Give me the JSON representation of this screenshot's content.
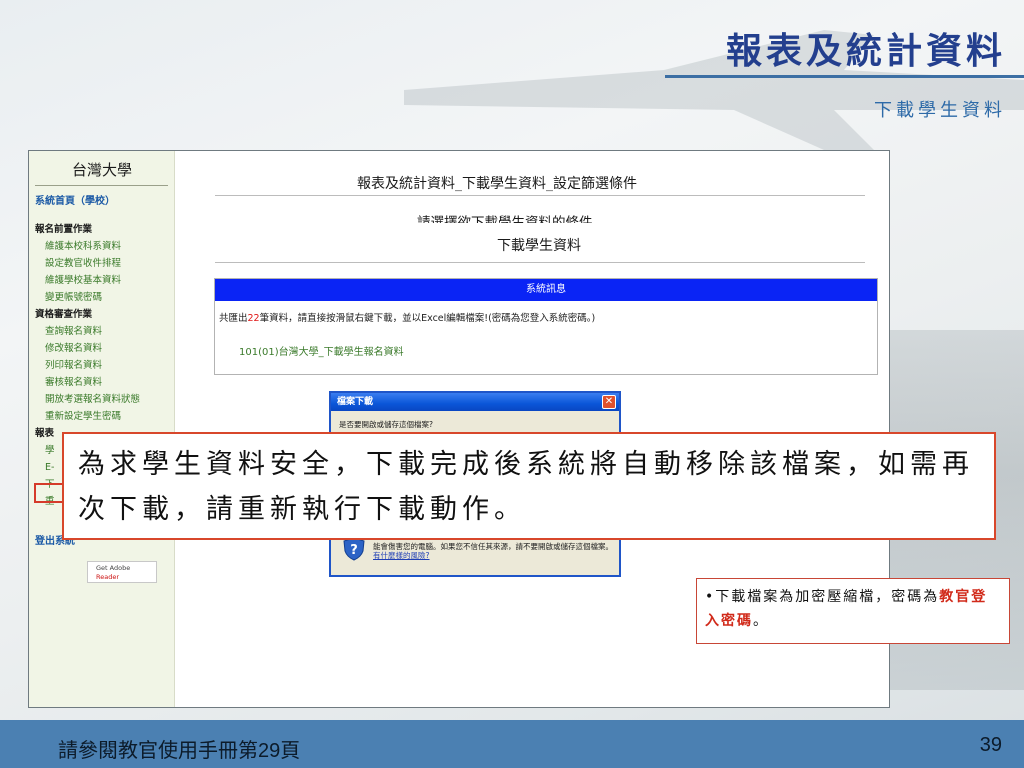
{
  "slide": {
    "title": "報表及統計資料",
    "subtitle": "下載學生資料",
    "footer_left": "請參閱教官使用手冊第29頁",
    "page_number": "39"
  },
  "sidebar": {
    "school": "台灣大學",
    "home": "系統首頁（學校）",
    "items": [
      {
        "label": "報名前置作業",
        "heading": true
      },
      {
        "label": "維護本校科系資料",
        "heading": false
      },
      {
        "label": "設定教官收件排程",
        "heading": false
      },
      {
        "label": "維護學校基本資料",
        "heading": false
      },
      {
        "label": "變更帳號密碼",
        "heading": false
      },
      {
        "label": "資格審查作業",
        "heading": true
      },
      {
        "label": "查詢報名資料",
        "heading": false
      },
      {
        "label": "修改報名資料",
        "heading": false
      },
      {
        "label": "列印報名資料",
        "heading": false
      },
      {
        "label": "審核報名資料",
        "heading": false
      },
      {
        "label": "開放考選報名資料狀態",
        "heading": false
      },
      {
        "label": "重新設定學生密碼",
        "heading": false
      },
      {
        "label": "報表",
        "heading": true
      },
      {
        "label": "學",
        "heading": false
      },
      {
        "label": "E-",
        "heading": false
      },
      {
        "label": "下",
        "heading": false
      },
      {
        "label": "重",
        "heading": false
      }
    ],
    "logout": "登出系統",
    "adobe": {
      "get": "Get Adobe",
      "reader": "Reader"
    }
  },
  "main": {
    "title": "報表及統計資料_下載學生資料_設定篩選條件",
    "sub": "請選擇欲下載學生資料的條件",
    "heading": "下載學生資料",
    "message": {
      "bar": "系統訊息",
      "prefix": "共匯出",
      "count": "22",
      "suffix": "筆資料，請直接按滑鼠右鍵下載，並以Excel編輯檔案!(密碼為您登入系統密碼。)",
      "link": "101(01)台灣大學_下載學生報名資料"
    }
  },
  "dialog": {
    "title": "檔案下載",
    "close": "✕",
    "question": "是否要開啟或儲存這個檔案?",
    "warning": "能會傷害您的電腦。如果您不信任其來源，請不要開啟或儲存這個檔案。",
    "risk_link": "有什麼樣的風險?"
  },
  "callout": {
    "text": "為求學生資料安全，下載完成後系統將自動移除該檔案，如需再次下載，請重新執行下載動作。"
  },
  "note": {
    "bullet": "•",
    "text1": "下載檔案為加密壓縮檔，密碼為",
    "password": "教官登入密碼",
    "text2": "。"
  },
  "colors": {
    "title": "#233f8e",
    "footer": "#4b80b2",
    "message_bar": "#0a24f5",
    "callout_border": "#d8472b",
    "highlight": "#d12a1a"
  }
}
